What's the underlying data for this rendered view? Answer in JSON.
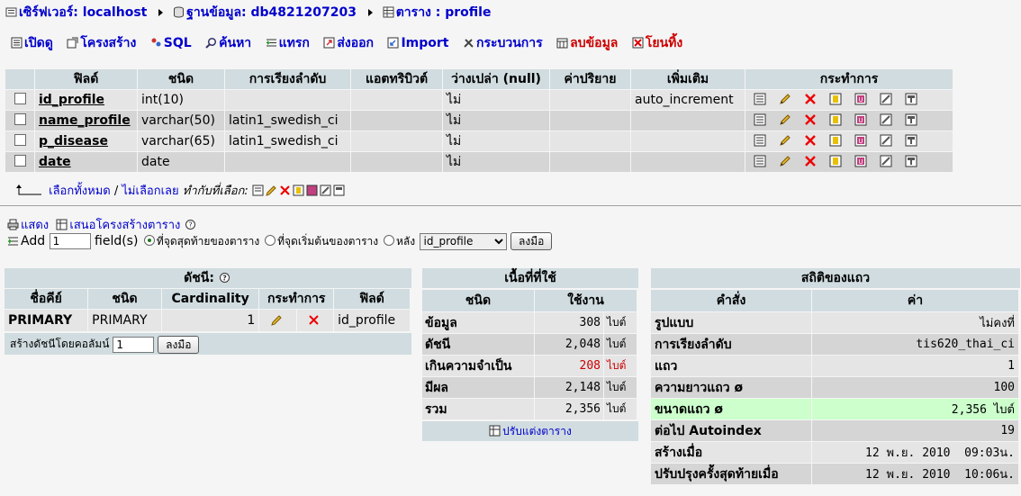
{
  "breadcrumb": {
    "server": "เซิร์ฟเวอร์: localhost",
    "database": "ฐานข้อมูล: db4821207203",
    "table": "ตาราง : profile"
  },
  "tabs": [
    {
      "label": "เปิดดู"
    },
    {
      "label": "โครงสร้าง"
    },
    {
      "label": "SQL"
    },
    {
      "label": "ค้นหา"
    },
    {
      "label": "แทรก"
    },
    {
      "label": "ส่งออก"
    },
    {
      "label": "Import"
    },
    {
      "label": "กระบวนการ"
    },
    {
      "label": "ลบข้อมูล"
    },
    {
      "label": "โยนทิ้ง"
    }
  ],
  "structure": {
    "headers": [
      "ฟิลด์",
      "ชนิด",
      "การเรียงลำดับ",
      "แอตทริบิวต์",
      "ว่างเปล่า (null)",
      "ค่าปริยาย",
      "เพิ่มเติม",
      "กระทำการ"
    ],
    "rows": [
      {
        "field": "id_profile",
        "type": "int(10)",
        "collation": "",
        "attributes": "",
        "null": "ไม่",
        "default": "",
        "extra": "auto_increment"
      },
      {
        "field": "name_profile",
        "type": "varchar(50)",
        "collation": "latin1_swedish_ci",
        "attributes": "",
        "null": "ไม่",
        "default": "",
        "extra": ""
      },
      {
        "field": "p_disease",
        "type": "varchar(65)",
        "collation": "latin1_swedish_ci",
        "attributes": "",
        "null": "ไม่",
        "default": "",
        "extra": ""
      },
      {
        "field": "date",
        "type": "date",
        "collation": "",
        "attributes": "",
        "null": "ไม่",
        "default": "",
        "extra": ""
      }
    ]
  },
  "checkall": {
    "select_all": "เลือกทั้งหมด",
    "divider": " / ",
    "unselect_all": "ไม่เลือกเลย",
    "with_selected": "ทำกับที่เลือก:"
  },
  "print_row": {
    "print": "แสดง",
    "propose": "เสนอโครงสร้างตาราง"
  },
  "add_row": {
    "add": "Add",
    "count": "1",
    "fields": "field(s)",
    "opt_end": "ที่จุดสุดท้ายของตาราง",
    "opt_begin": "ที่จุดเริ่มต้นของตาราง",
    "opt_after": "หลัง",
    "after_field": "id_profile",
    "go": "ลงมือ"
  },
  "indexes": {
    "title": "ดัชนี:",
    "headers": [
      "ชื่อคีย์",
      "ชนิด",
      "Cardinality",
      "กระทำการ",
      "ฟิลด์"
    ],
    "rows": [
      {
        "keyname": "PRIMARY",
        "type": "PRIMARY",
        "cardinality": "1",
        "field": "id_profile"
      }
    ],
    "create_label": "สร้างดัชนีโดยคอลัมน์",
    "create_count": "1",
    "go": "ลงมือ"
  },
  "space": {
    "title": "เนื้อที่ที่ใช้",
    "headers": [
      "ชนิด",
      "ใช้งาน"
    ],
    "rows": [
      {
        "type": "ข้อมูล",
        "value": "308",
        "unit": "ไบต์",
        "warn": false
      },
      {
        "type": "ดัชนี",
        "value": "2,048",
        "unit": "ไบต์",
        "warn": false
      },
      {
        "type": "เกินความจำเป็น",
        "value": "208",
        "unit": "ไบต์",
        "warn": true
      },
      {
        "type": "มีผล",
        "value": "2,148",
        "unit": "ไบต์",
        "warn": false
      },
      {
        "type": "รวม",
        "value": "2,356",
        "unit": "ไบต์",
        "warn": false
      }
    ],
    "optimize": "ปรับแต่งตาราง"
  },
  "row_stats": {
    "title": "สถิติของแถว",
    "headers": [
      "คำสั่ง",
      "ค่า"
    ],
    "rows": [
      {
        "label": "รูปแบบ",
        "value": "ไม่คงที่"
      },
      {
        "label": "การเรียงลำดับ",
        "value": "tis620_thai_ci"
      },
      {
        "label": "แถว",
        "value": "1"
      },
      {
        "label": "ความยาวแถว ø",
        "value": "100"
      },
      {
        "label": "ขนาดแถว ø",
        "value": "2,356 ไบต์"
      },
      {
        "label": "ต่อไป Autoindex",
        "value": "19"
      },
      {
        "label": "สร้างเมื่อ",
        "value": "12 พ.ย. 2010  09:03น."
      },
      {
        "label": "ปรับปรุงครั้งสุดท้ายเมื่อ",
        "value": "12 พ.ย. 2010  10:06น."
      }
    ]
  },
  "colors": {
    "header_bg": "#d0dce0",
    "row_odd": "#e5e5e5",
    "row_even": "#d5d5d5",
    "link": "#0000cc",
    "danger": "#cc0000",
    "highlight": "#ccffcc"
  }
}
